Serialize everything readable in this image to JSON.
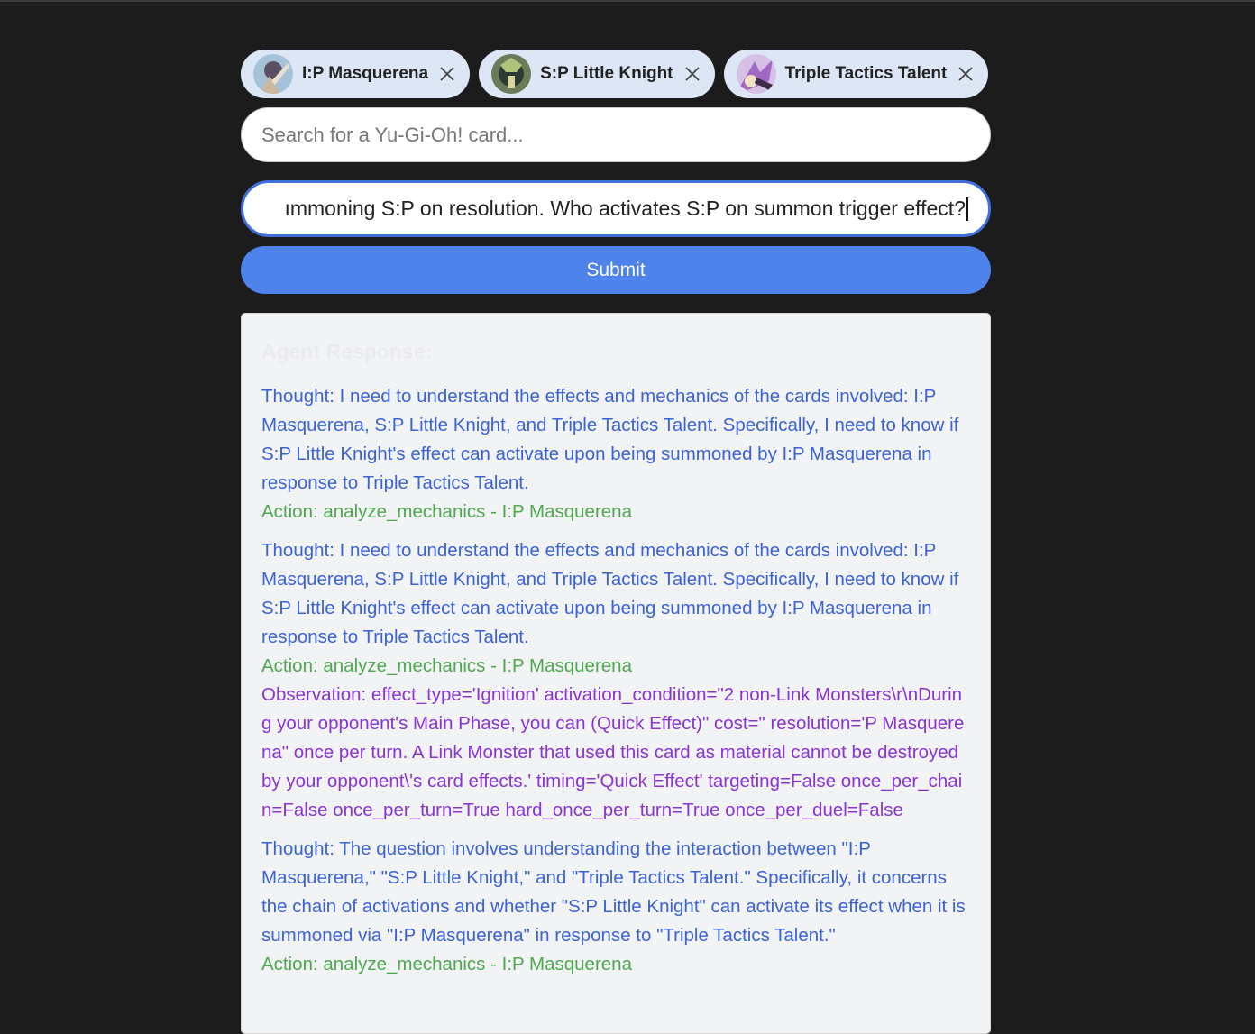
{
  "chips": [
    {
      "label": "I:P Masquerena",
      "thumb_colors": [
        "#c9b7a0",
        "#5b4f63",
        "#a4c3d9"
      ]
    },
    {
      "label": "S:P Little Knight",
      "thumb_colors": [
        "#2d3a32",
        "#b1c27a",
        "#6b7b5a"
      ]
    },
    {
      "label": "Triple Tactics Talent",
      "thumb_colors": [
        "#d7c0e6",
        "#a269c2",
        "#f0e1c2"
      ]
    }
  ],
  "search": {
    "placeholder": "Search for a Yu-Gi-Oh! card...",
    "value": ""
  },
  "question": {
    "visible_text": "ımmoning S:P on resolution. Who activates S:P on summon trigger effect?"
  },
  "submit_label": "Submit",
  "response": {
    "title": "Agent Response:",
    "steps": [
      {
        "thought": "Thought: I need to understand the effects and mechanics of the cards involved: I:P Masquerena, S:P Little Knight, and Triple Tactics Talent. Specifically, I need to know if S:P Little Knight's effect can activate upon being summoned by I:P Masquerena in response to Triple Tactics Talent.",
        "action": "Action: analyze_mechanics - I:P Masquerena"
      },
      {
        "thought": "Thought: I need to understand the effects and mechanics of the cards involved: I:P Masquerena, S:P Little Knight, and Triple Tactics Talent. Specifically, I need to know if S:P Little Knight's effect can activate upon being summoned by I:P Masquerena in response to Triple Tactics Talent.",
        "action": "Action: analyze_mechanics - I:P Masquerena",
        "observation": "Observation: effect_type='Ignition' activation_condition=\"2 non-Link Monsters\\r\\nDuring your opponent's Main Phase, you can (Quick Effect)\" cost=\" resolution='P Masquerena\" once per turn. A Link Monster that used this card as material cannot be destroyed by your opponent\\'s card effects.' timing='Quick Effect' targeting=False once_per_chain=False once_per_turn=True hard_once_per_turn=True once_per_duel=False"
      },
      {
        "thought": "Thought: The question involves understanding the interaction between \"I:P Masquerena,\" \"S:P Little Knight,\" and \"Triple Tactics Talent.\" Specifically, it concerns the chain of activations and whether \"S:P Little Knight\" can activate its effect when it is summoned via \"I:P Masquerena\" in response to \"Triple Tactics Talent.\"",
        "action": "Action: analyze_mechanics - I:P Masquerena"
      }
    ]
  }
}
